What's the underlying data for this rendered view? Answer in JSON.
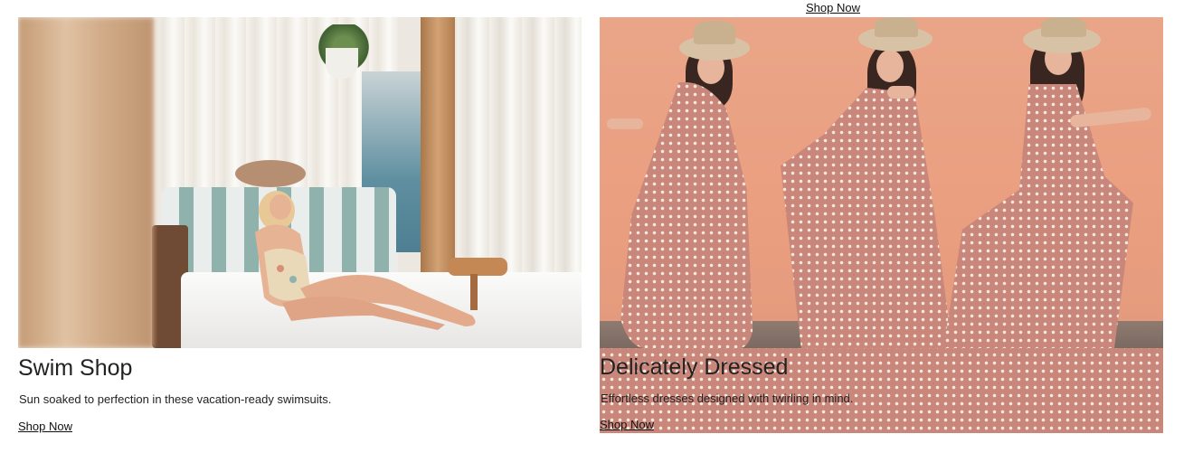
{
  "top": {
    "shop_now_label": "Shop Now"
  },
  "cards": [
    {
      "title": "Swim Shop",
      "description": "Sun soaked to perfection in these vacation-ready swimsuits.",
      "link_label": "Shop Now"
    },
    {
      "title": "Delicately Dressed",
      "description": "Effortless dresses designed with twirling in mind.",
      "link_label": "Shop Now"
    }
  ],
  "colors": {
    "text": "#222222",
    "link": "#111111",
    "background": "#ffffff",
    "dress_wall": "#ea9f80"
  }
}
